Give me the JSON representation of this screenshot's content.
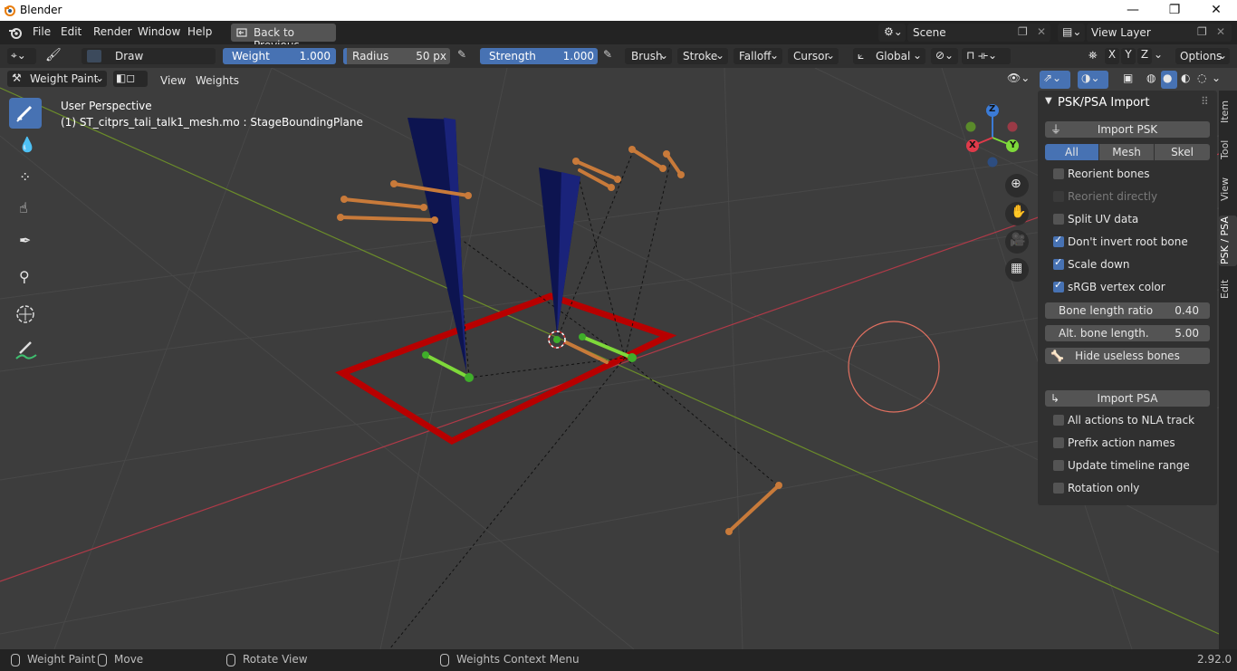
{
  "window": {
    "title": "Blender",
    "minimize": "—",
    "maximize": "❐",
    "close": "✕"
  },
  "menubar": {
    "items": [
      "File",
      "Edit",
      "Render",
      "Window",
      "Help"
    ],
    "back_button": "Back to Previous",
    "scene_label": "Scene",
    "view_layer_label": "View Layer"
  },
  "tool_header": {
    "brush_name": "Draw",
    "weight_label": "Weight",
    "weight_value": "1.000",
    "radius_label": "Radius",
    "radius_value": "50 px",
    "strength_label": "Strength",
    "strength_value": "1.000",
    "brush_menu": "Brush",
    "stroke_menu": "Stroke",
    "falloff_menu": "Falloff",
    "cursor_menu": "Cursor",
    "orientation": "Global",
    "axes": [
      "X",
      "Y",
      "Z"
    ],
    "options_menu": "Options"
  },
  "viewport_header": {
    "mode": "Weight Paint",
    "view_menu": "View",
    "weights_menu": "Weights"
  },
  "viewport": {
    "perspective_label": "User Perspective",
    "object_label": "(1) ST_citprs_tali_talk1_mesh.mo : StageBoundingPlane",
    "gizmo_axes": {
      "x": "X",
      "y": "Y",
      "z": "Z"
    }
  },
  "npanel": {
    "title": "PSK/PSA Import",
    "import_psk": "Import PSK",
    "filter_tabs": [
      "All",
      "Mesh",
      "Skel"
    ],
    "psk_options": [
      {
        "label": "Reorient bones",
        "checked": false,
        "enabled": true
      },
      {
        "label": "Reorient directly",
        "checked": false,
        "enabled": false
      },
      {
        "label": "Split UV data",
        "checked": false,
        "enabled": true
      },
      {
        "label": "Don't invert root bone",
        "checked": true,
        "enabled": true
      },
      {
        "label": "Scale down",
        "checked": true,
        "enabled": true
      },
      {
        "label": "sRGB vertex color",
        "checked": true,
        "enabled": true
      }
    ],
    "bone_length_ratio": {
      "label": "Bone length ratio",
      "value": "0.40"
    },
    "alt_bone_length": {
      "label": "Alt. bone length.",
      "value": "5.00"
    },
    "hide_useless_bones": "Hide useless bones",
    "import_psa": "Import PSA",
    "psa_options": [
      {
        "label": "All actions to NLA track",
        "checked": false
      },
      {
        "label": "Prefix action names",
        "checked": false
      },
      {
        "label": "Update timeline range",
        "checked": false
      },
      {
        "label": "Rotation only",
        "checked": false
      }
    ]
  },
  "side_tabs": [
    "Item",
    "Tool",
    "View",
    "PSK / PSA",
    "Edit"
  ],
  "statusbar": {
    "left_click": "Weight Paint",
    "middle_click": "Move",
    "right_click": "Rotate View",
    "context": "Weights Context Menu",
    "version": "2.92.0"
  },
  "colors": {
    "accent": "#4772b3",
    "bone": "#c87a3a",
    "selected_bone": "#7ed93a",
    "boundary": "#b80000",
    "mesh": "#0d1450"
  }
}
